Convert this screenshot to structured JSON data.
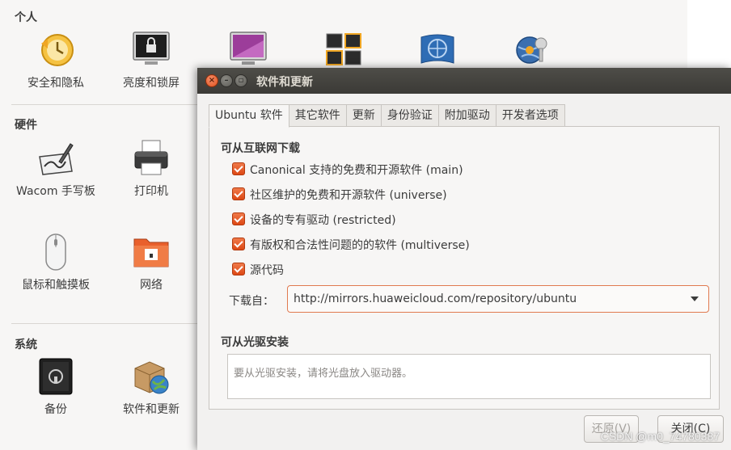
{
  "settings": {
    "sections": {
      "personal": "个人",
      "hardware": "硬件",
      "system": "系统"
    },
    "personal_items": [
      {
        "label": "安全和隐私",
        "icon": "security-privacy-icon"
      },
      {
        "label": "亮度和锁屏",
        "icon": "brightness-lock-icon"
      },
      {
        "label": "",
        "icon": "appearance-icon"
      },
      {
        "label": "",
        "icon": "workspaces-icon"
      },
      {
        "label": "",
        "icon": "language-icon"
      },
      {
        "label": "",
        "icon": "online-accounts-icon"
      }
    ],
    "hardware_items": [
      {
        "label": "Wacom 手写板",
        "icon": "wacom-tablet-icon"
      },
      {
        "label": "打印机",
        "icon": "printer-icon"
      },
      {
        "label": "鼠标和触摸板",
        "icon": "mouse-icon"
      },
      {
        "label": "网络",
        "icon": "network-icon"
      }
    ],
    "system_items": [
      {
        "label": "备份",
        "icon": "backup-icon"
      },
      {
        "label": "软件和更新",
        "icon": "software-updates-icon"
      }
    ]
  },
  "dialog": {
    "title": "软件和更新",
    "tabs": [
      "Ubuntu 软件",
      "其它软件",
      "更新",
      "身份验证",
      "附加驱动",
      "开发者选项"
    ],
    "active_tab": "Ubuntu 软件",
    "internet_heading": "可从互联网下载",
    "checkboxes": [
      {
        "label": "Canonical 支持的免费和开源软件 (main)",
        "checked": true
      },
      {
        "label": "社区维护的免费和开源软件 (universe)",
        "checked": true
      },
      {
        "label": "设备的专有驱动 (restricted)",
        "checked": true
      },
      {
        "label": "有版权和合法性问题的的软件 (multiverse)",
        "checked": true
      },
      {
        "label": "源代码",
        "checked": true
      }
    ],
    "download_label": "下载自：",
    "download_from": "http://mirrors.huaweicloud.com/repository/ubuntu",
    "cdrom_heading": "可从光驱安装",
    "cdrom_message": "要从光驱安装，请将光盘放入驱动器。",
    "revert_label": "还原(V)",
    "close_label": "关闭(C)"
  },
  "watermark": "CSDN @m0_74780387",
  "colors": {
    "accent": "#dd4814",
    "titlebar": "#3b3a36",
    "background": "#f2f1f0"
  }
}
